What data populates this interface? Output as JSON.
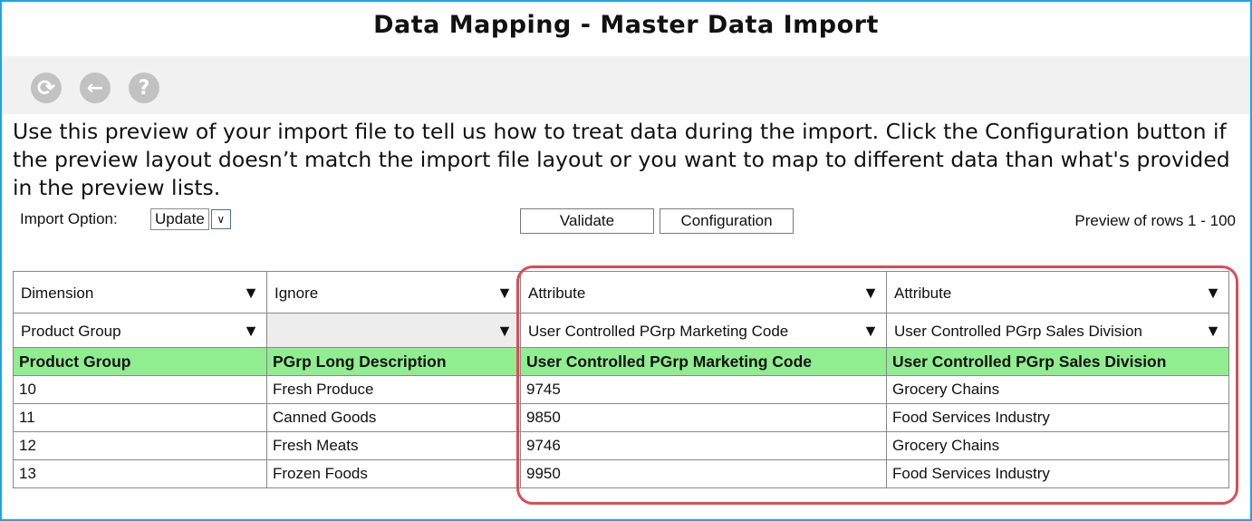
{
  "title": "Data Mapping - Master Data Import",
  "toolbar": {
    "icons": [
      "refresh-icon",
      "back-icon",
      "help-icon"
    ],
    "glyphs": {
      "refresh": "⟳",
      "back": "←",
      "help": "?"
    }
  },
  "intro_text": "Use this preview of your import file to tell us how to treat data during the import. Click the Configuration button if the preview layout doesn’t match the import file layout or you want to map to different data than what's provided in the preview lists.",
  "options": {
    "import_option_label": "Import Option:",
    "import_option_value": "Update",
    "validate_label": "Validate",
    "configuration_label": "Configuration",
    "preview_text": "Preview of rows 1 - 100"
  },
  "grid": {
    "type_row": [
      "Dimension",
      "Ignore",
      "Attribute",
      "Attribute"
    ],
    "field_row": [
      "Product Group",
      "",
      "User Controlled PGrp Marketing Code",
      "User Controlled PGrp Sales Division"
    ],
    "headers": [
      "Product Group",
      "PGrp Long Description",
      "User Controlled PGrp Marketing Code",
      "User Controlled PGrp Sales Division"
    ],
    "rows": [
      [
        "10",
        "Fresh Produce",
        "9745",
        "Grocery Chains"
      ],
      [
        "11",
        "Canned Goods",
        "9850",
        "Food Services Industry"
      ],
      [
        "12",
        "Fresh Meats",
        "9746",
        "Grocery Chains"
      ],
      [
        "13",
        "Frozen Foods",
        "9950",
        "Food Services Industry"
      ]
    ],
    "dropdown_glyph": "▼"
  },
  "colors": {
    "frame": "#1fa3e6",
    "header_bg": "#90ee90",
    "highlight": "#e04a57",
    "toolbar_bg": "#f1f1f1"
  }
}
